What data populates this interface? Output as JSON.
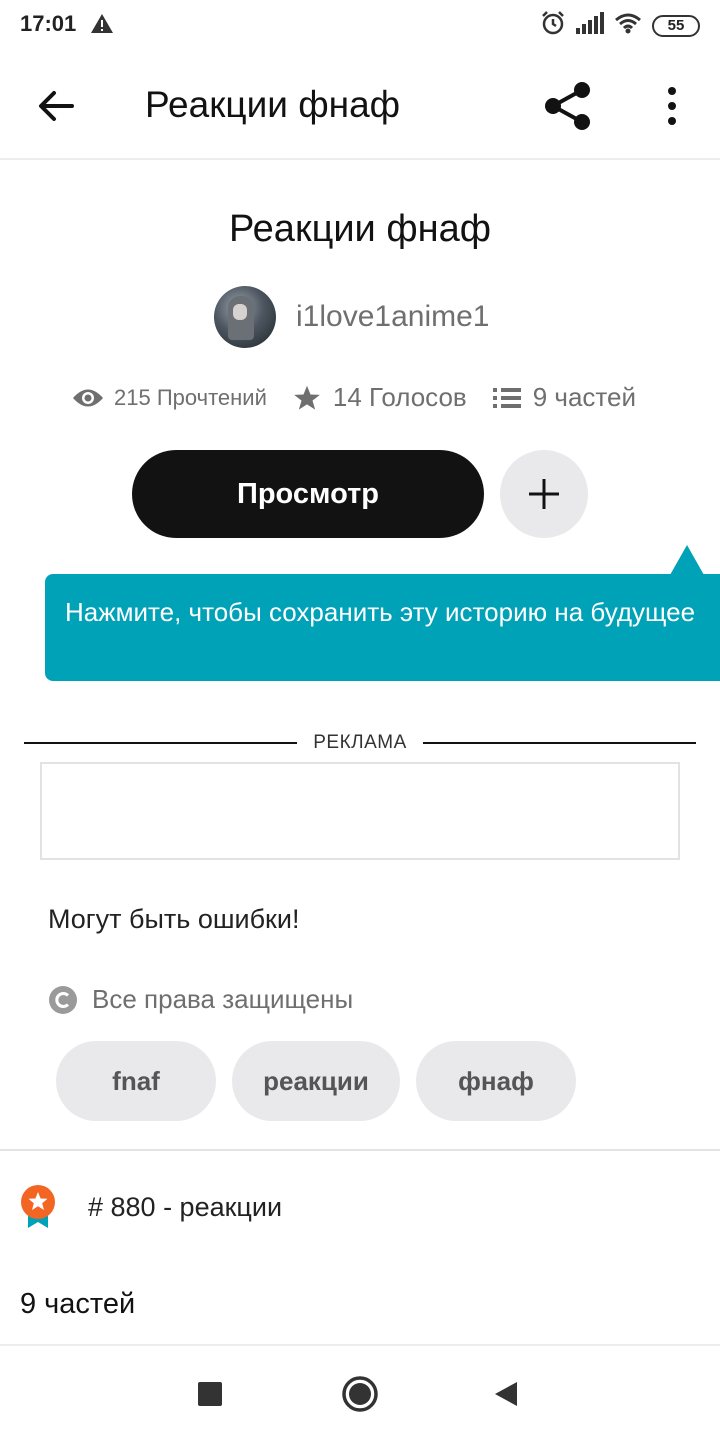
{
  "status_bar": {
    "time": "17:01",
    "battery": "55",
    "icons": [
      "warning-icon",
      "alarm-icon",
      "signal-icon",
      "wifi-icon",
      "battery-icon"
    ]
  },
  "app_bar": {
    "title": "Реакции фнаф"
  },
  "story": {
    "title": "Реакции фнаф",
    "author": "i1love1anime1",
    "reads": "215 Прочтений",
    "votes": "14 Голосов",
    "parts": "9 частей"
  },
  "actions": {
    "view_label": "Просмотр"
  },
  "tooltip": {
    "text": "Нажмите, чтобы сохранить эту историю на будущее"
  },
  "ad": {
    "label": "РЕКЛАМА"
  },
  "description": "Могут быть ошибки!",
  "copyright": "Все права защищены",
  "tags": [
    "fnaf",
    "реакции",
    "фнаф"
  ],
  "ranking": {
    "text": "# 880 - реакции"
  },
  "parts_section": {
    "label": "9 частей"
  },
  "colors": {
    "accent": "#00a2b8",
    "primary_button": "#121212",
    "chip": "#e9e9ec",
    "badge": "#f26522",
    "ribbon": "#00a2b8"
  }
}
